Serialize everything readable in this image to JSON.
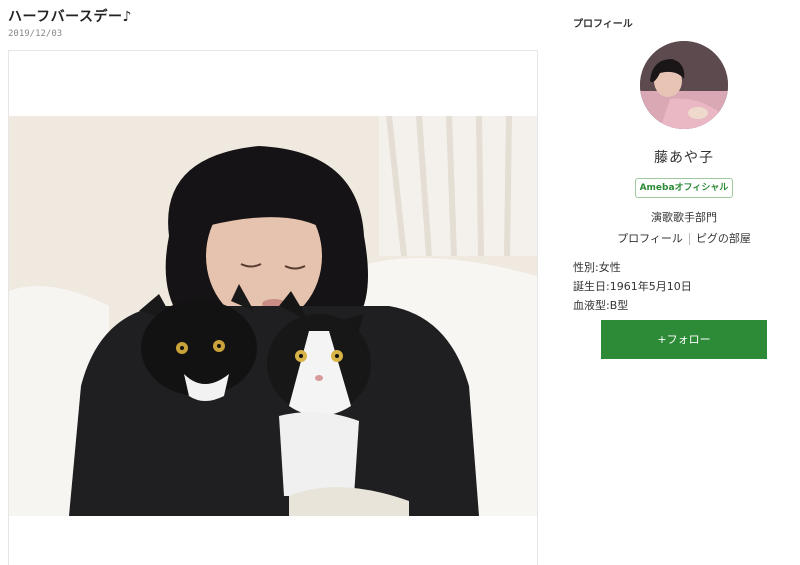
{
  "post": {
    "title": "ハーフバースデー♪",
    "date": "2019/12/03"
  },
  "sidebar": {
    "heading": "プロフィール",
    "name": "藤あや子",
    "badge": "Amebaオフィシャル",
    "category": "演歌歌手部門",
    "links": [
      "プロフィール",
      "ピグの部屋"
    ],
    "details": [
      "性別:女性",
      "誕生日:1961年5月10日",
      "血液型:B型"
    ],
    "follow_label": "+フォロー"
  },
  "colors": {
    "accent": "#2d8a36",
    "badge_border": "#9fc89f"
  }
}
